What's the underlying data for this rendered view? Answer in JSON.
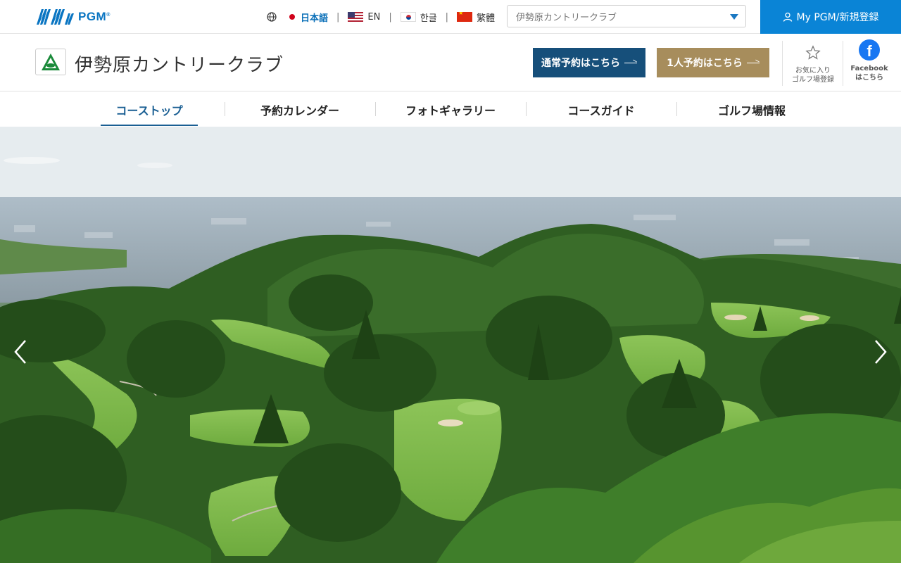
{
  "brand": {
    "name": "PGM",
    "mark": "®"
  },
  "languages": [
    {
      "label": "日本語",
      "active": true
    },
    {
      "label": "EN"
    },
    {
      "label": "한글"
    },
    {
      "label": "繁體"
    }
  ],
  "course_select": {
    "value": "伊勢原カントリークラブ"
  },
  "account": {
    "label": "My PGM/新規登録"
  },
  "course": {
    "name": "伊勢原カントリークラブ",
    "reserve_normal": "通常予約はこちら",
    "reserve_single": "1人予約はこちら",
    "favorite_line1": "お気に入り",
    "favorite_line2": "ゴルフ場登録",
    "facebook_line1": "Facebook",
    "facebook_line2": "はこちら"
  },
  "nav": {
    "items": [
      {
        "label": "コーストップ",
        "active": true
      },
      {
        "label": "予約カレンダー"
      },
      {
        "label": "フォトギャラリー"
      },
      {
        "label": "コースガイド"
      },
      {
        "label": "ゴルフ場情報"
      }
    ]
  },
  "colors": {
    "primary": "#0a84d6",
    "navy": "#164f7a",
    "gold": "#a78d5c",
    "facebook": "#1877f2"
  }
}
